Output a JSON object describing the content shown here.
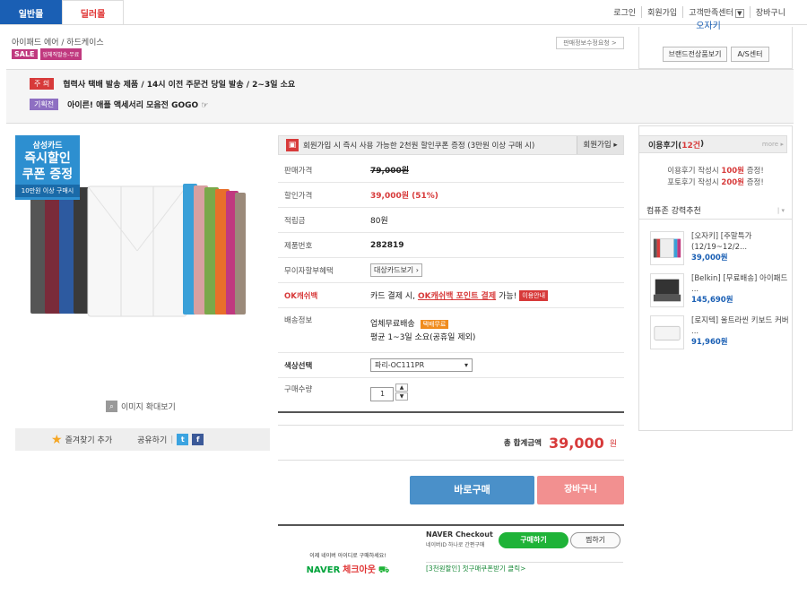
{
  "tabs": {
    "general": "일반몰",
    "dealer": "딜러몰"
  },
  "utils": {
    "login": "로그인",
    "join": "회원가입",
    "cs": "고객만족센터",
    "cart": "장바구니"
  },
  "product": {
    "breadcrumb": "아이패드 에어 / 하드케이스",
    "sale_badge": "SALE",
    "sale_sub": "업체직발송-무료",
    "info_button": "판매정보수정요청 >"
  },
  "brand": {
    "title": "오자키",
    "brand_button": "브랜드전상품보기",
    "as_button": "A/S센터"
  },
  "notices": [
    {
      "badge": "주 의",
      "badge_color": "#d73a3a",
      "text": "협력사 택배 발송 제품 / 14시 이전 주문건 당일 발송 / 2~3일 소요"
    },
    {
      "badge": "기획전",
      "badge_color": "#8e6fc2",
      "text": "아이른! 애플 액세서리 모음전 GOGO ☞"
    }
  ],
  "promo": {
    "card": "삼성카드",
    "line1": "즉시할인",
    "line2": "쿠폰 증정",
    "cond": "10만원 이상 구매시"
  },
  "image_actions": {
    "zoom": "이미지 확대보기",
    "favorite": "즐겨찾기 추가",
    "share": "공유하기"
  },
  "coupon": {
    "text": "회원가입 시 즉시 사용 가능한 2천원 할인쿠폰 증정 (3만원 이상 구매 시)",
    "button": "회원가입"
  },
  "details": {
    "sale_price_label": "판매가격",
    "sale_price": "79,000원",
    "discount_price_label": "할인가격",
    "discount_price": "39,000원 (51%)",
    "points_label": "적립금",
    "points": "80원",
    "product_no_label": "제품번호",
    "product_no": "282819",
    "installment_label": "무이자할부혜택",
    "installment_button": "대상카드보기",
    "ok_label": "OK캐쉬백",
    "ok_text1": "카드 결제 시,",
    "ok_text2": "OK캐쉬백 포인트 결제",
    "ok_text3": "가능!",
    "ok_tag": "이용안내",
    "shipping_label": "배송정보",
    "shipping1": "업체무료배송",
    "shipping_tag": "택배무료",
    "shipping2": "평균 1~3일 소요(공휴일 제외)",
    "color_label": "색상선택",
    "color_value": "파리-OC111PR",
    "qty_label": "구매수량",
    "qty_value": "1"
  },
  "total": {
    "label": "총 합계금액",
    "value": "39,000",
    "unit": "원"
  },
  "buttons": {
    "buy": "바로구매",
    "cart": "장바구니"
  },
  "naver": {
    "promo1": "이제 네이버 아이디로 구매하세요!",
    "logo1": "NAVER",
    "logo2": "체크아웃",
    "checkout": "NAVER Checkout",
    "sub": "네이버ID 하나로 간편구매",
    "buy": "구매하기",
    "zzim": "찜하기",
    "link": "[3천원할인] 첫구매쿠폰받기 클릭>"
  },
  "review": {
    "title_a": "이용후기(",
    "count": "12건",
    "title_b": ")",
    "more": "more",
    "line1_a": "이용후기 작성시",
    "line1_b": "100원",
    "line1_c": "증정!",
    "line2_a": "포토후기 작성시",
    "line2_b": "200원",
    "line2_c": "증정!"
  },
  "recommend": {
    "title": "컴퓨존 강력추천",
    "items": [
      {
        "name": "[오자키] [주말특가 (12/19~12/2...",
        "price": "39,000원"
      },
      {
        "name": "[Belkin] [무료배송] 아이패드 ...",
        "price": "145,690원"
      },
      {
        "name": "[로지텍] 울트라씬 키보드 커버 ...",
        "price": "91,960원"
      }
    ]
  }
}
